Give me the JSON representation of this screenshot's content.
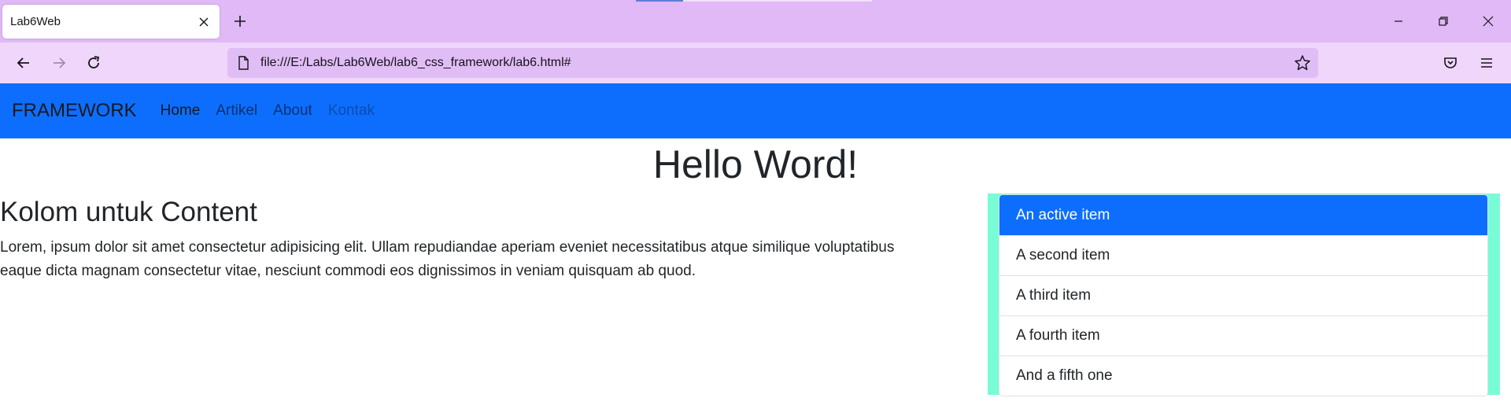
{
  "browser": {
    "tab_title": "Lab6Web",
    "url": "file:///E:/Labs/Lab6Web/lab6_css_framework/lab6.html#"
  },
  "site": {
    "brand": "FRAMEWORK",
    "nav": [
      "Home",
      "Artikel",
      "About",
      "Kontak"
    ],
    "hero": "Hello Word!",
    "content_heading": "Kolom untuk Content",
    "content_paragraph_lines": [
      "Lorem, ipsum dolor sit amet consectetur adipisicing elit. Ullam repudiandae aperiam eveniet necessitatibus atque similique voluptatibus",
      "eaque dicta magnam consectetur vitae, nesciunt commodi eos dignissimos in veniam quisquam ab quod."
    ],
    "list_items": [
      "An active item",
      "A second item",
      "A third item",
      "A fourth item",
      "And a fifth one"
    ]
  },
  "colors": {
    "primary": "#0d6efd",
    "sidebar_bg": "#79fcd6",
    "tabbar_bg": "#e0b9f6",
    "toolbar_bg": "#efd6fa"
  }
}
